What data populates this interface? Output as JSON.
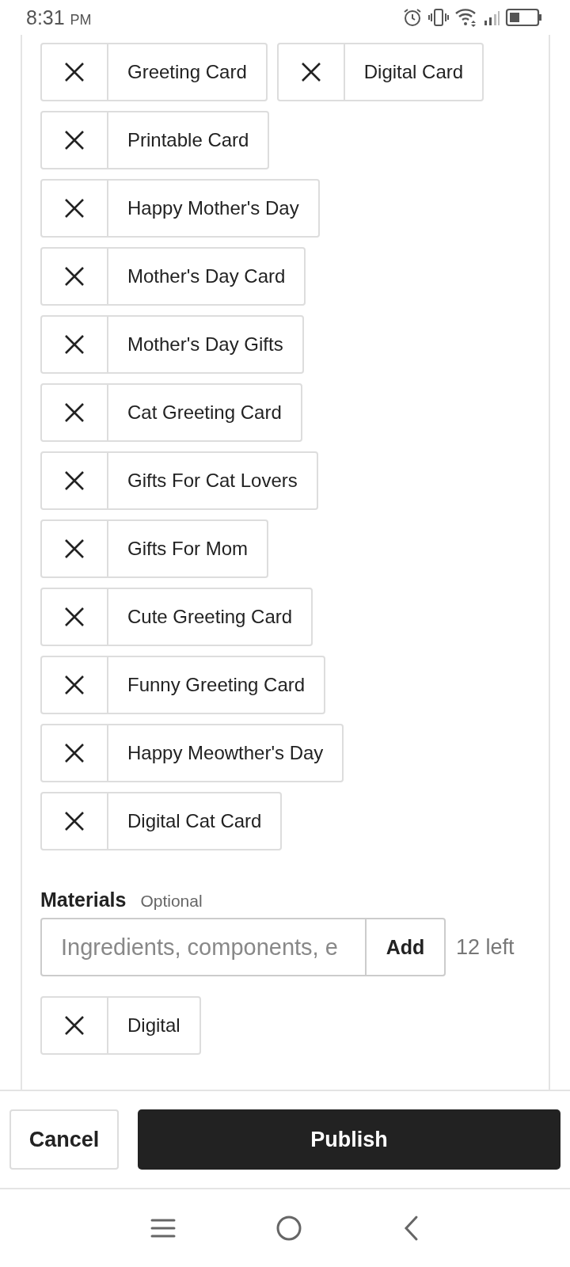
{
  "status_bar": {
    "time": "8:31",
    "period": "PM"
  },
  "tags": [
    {
      "label": "Greeting Card"
    },
    {
      "label": "Digital Card"
    },
    {
      "label": "Printable Card"
    },
    {
      "label": "Happy Mother's Day"
    },
    {
      "label": "Mother's Day Card"
    },
    {
      "label": "Mother's Day Gifts"
    },
    {
      "label": "Cat Greeting Card"
    },
    {
      "label": "Gifts For Cat Lovers"
    },
    {
      "label": "Gifts For Mom"
    },
    {
      "label": "Cute Greeting Card"
    },
    {
      "label": "Funny Greeting Card"
    },
    {
      "label": "Happy Meowther's Day"
    },
    {
      "label": "Digital Cat Card"
    }
  ],
  "materials": {
    "title": "Materials",
    "hint": "Optional",
    "placeholder": "Ingredients, components, e",
    "add_button": "Add",
    "remaining": "12 left",
    "tags": [
      {
        "label": "Digital"
      }
    ]
  },
  "footer": {
    "cancel": "Cancel",
    "publish": "Publish"
  }
}
